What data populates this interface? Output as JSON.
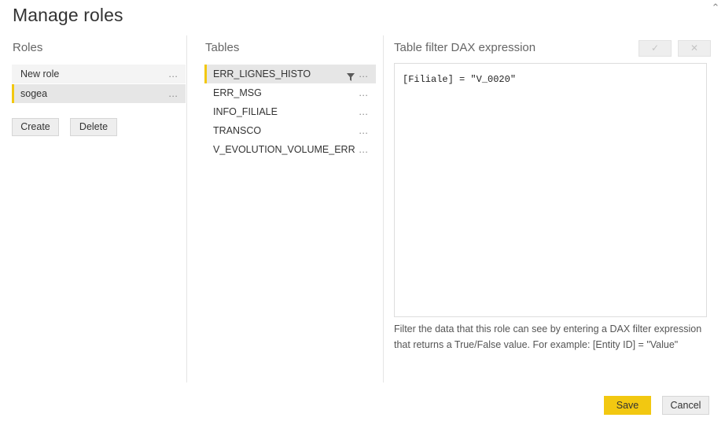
{
  "window": {
    "title": "Manage roles",
    "close_icon": "close-icon",
    "close_glyph": "⌃"
  },
  "roles_panel": {
    "heading": "Roles",
    "items": [
      {
        "label": "New role",
        "selected": false,
        "menu_glyph": "…"
      },
      {
        "label": "sogea",
        "selected": true,
        "menu_glyph": "…"
      }
    ],
    "create_label": "Create",
    "delete_label": "Delete"
  },
  "tables_panel": {
    "heading": "Tables",
    "items": [
      {
        "label": "ERR_LIGNES_HISTO",
        "selected": true,
        "has_filter": true,
        "menu_glyph": "…"
      },
      {
        "label": "ERR_MSG",
        "selected": false,
        "has_filter": false,
        "menu_glyph": "…"
      },
      {
        "label": "INFO_FILIALE",
        "selected": false,
        "has_filter": false,
        "menu_glyph": "…"
      },
      {
        "label": "TRANSCO",
        "selected": false,
        "has_filter": false,
        "menu_glyph": "…"
      },
      {
        "label": "V_EVOLUTION_VOLUME_ERR",
        "selected": false,
        "has_filter": false,
        "menu_glyph": "…"
      }
    ]
  },
  "dax_panel": {
    "heading": "Table filter DAX expression",
    "accept_glyph": "✓",
    "reject_glyph": "✕",
    "expression": "[Filiale] = \"V_0020\"",
    "placeholder": "",
    "help_text": "Filter the data that this role can see by entering a DAX filter expression that returns a True/False value. For example: [Entity ID] = \"Value\""
  },
  "footer": {
    "save_label": "Save",
    "cancel_label": "Cancel"
  },
  "colors": {
    "accent": "#f2c811",
    "selected_row": "#e6e6e6",
    "row_background": "#f4f4f4",
    "divider": "#e5e5e5",
    "text": "#333333",
    "muted_text": "#666666"
  }
}
